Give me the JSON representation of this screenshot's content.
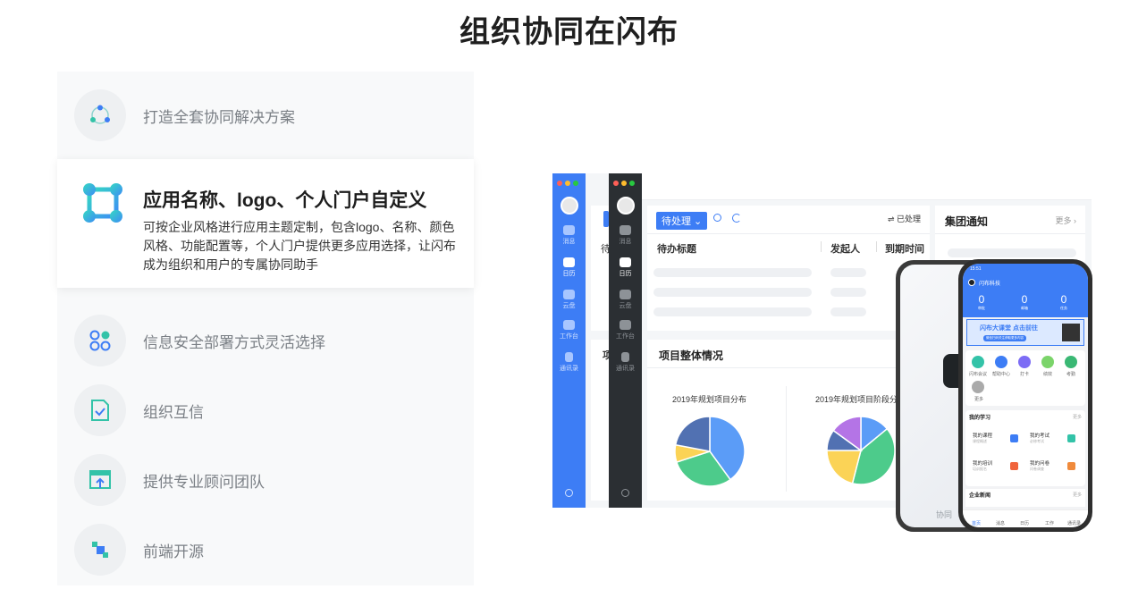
{
  "title": "组织协同在闪布",
  "menu": {
    "items": [
      {
        "label": "打造全套协同解决方案"
      },
      {
        "label": "信息安全部署方式灵活选择"
      },
      {
        "label": "组织互信"
      },
      {
        "label": "提供专业顾问团队"
      },
      {
        "label": "前端开源"
      }
    ],
    "active": {
      "title": "应用名称、logo、个人门户自定义",
      "desc": "可按企业风格进行应用主题定制，包含logo、名称、颜色风格、功能配置等，个人门户提供更多应用选择，让闪布成为组织和用户的专属协同助手"
    }
  },
  "mock": {
    "sidebar": [
      "消息",
      "日历",
      "云盘",
      "工作台",
      "通讯录"
    ],
    "todo_dropdown": "待处理",
    "processed": "⇌ 已处理",
    "col_title": "待办标题",
    "col_sender": "发起人",
    "col_due": "到期时间",
    "notice_title": "集团通知",
    "more": "更多",
    "overview_title": "项目整体情况",
    "pie1_title": "2019年规划项目分布",
    "pie2_title": "2019年规划项目阶段分",
    "partial_left_1": "待",
    "partial_left_2": "项",
    "behind_text": "协同",
    "phone": {
      "time": "15:51",
      "company": "闪布科技",
      "stats": [
        {
          "n": "0",
          "t": "审批"
        },
        {
          "n": "0",
          "t": "邮箱"
        },
        {
          "n": "0",
          "t": "任务"
        }
      ],
      "banner": "闪布大课堂 点击前往",
      "banner_sub": "微信扫码关注获取更多内容",
      "apps": [
        "闪布会议",
        "帮助中心",
        "打卡",
        "绩效",
        "考勤"
      ],
      "apps2": [
        "更多"
      ],
      "study_title": "我的学习",
      "study_more": "更多",
      "study": [
        {
          "t": "我的课程",
          "s": "课程概述"
        },
        {
          "t": "我的考试",
          "s": "必修考试"
        },
        {
          "t": "我的培训",
          "s": "培训报名"
        },
        {
          "t": "我的问卷",
          "s": "问卷调查"
        }
      ],
      "news_title": "企业新闻",
      "news_more": "更多",
      "tabs": [
        "首页",
        "消息",
        "日历",
        "工作",
        "通讯录"
      ]
    }
  },
  "chart_data": [
    {
      "type": "pie",
      "title": "2019年规划项目分布",
      "values": [
        40,
        30,
        8,
        22
      ],
      "colors": [
        "#5b9cf7",
        "#4dcb8b",
        "#fbd356",
        "#5171b2"
      ]
    },
    {
      "type": "pie",
      "title": "2019年规划项目阶段分",
      "values": [
        14,
        40,
        21,
        10,
        15
      ],
      "colors": [
        "#5b9cf7",
        "#4dcb8b",
        "#fbd356",
        "#5171b2",
        "#b474e6"
      ]
    }
  ]
}
